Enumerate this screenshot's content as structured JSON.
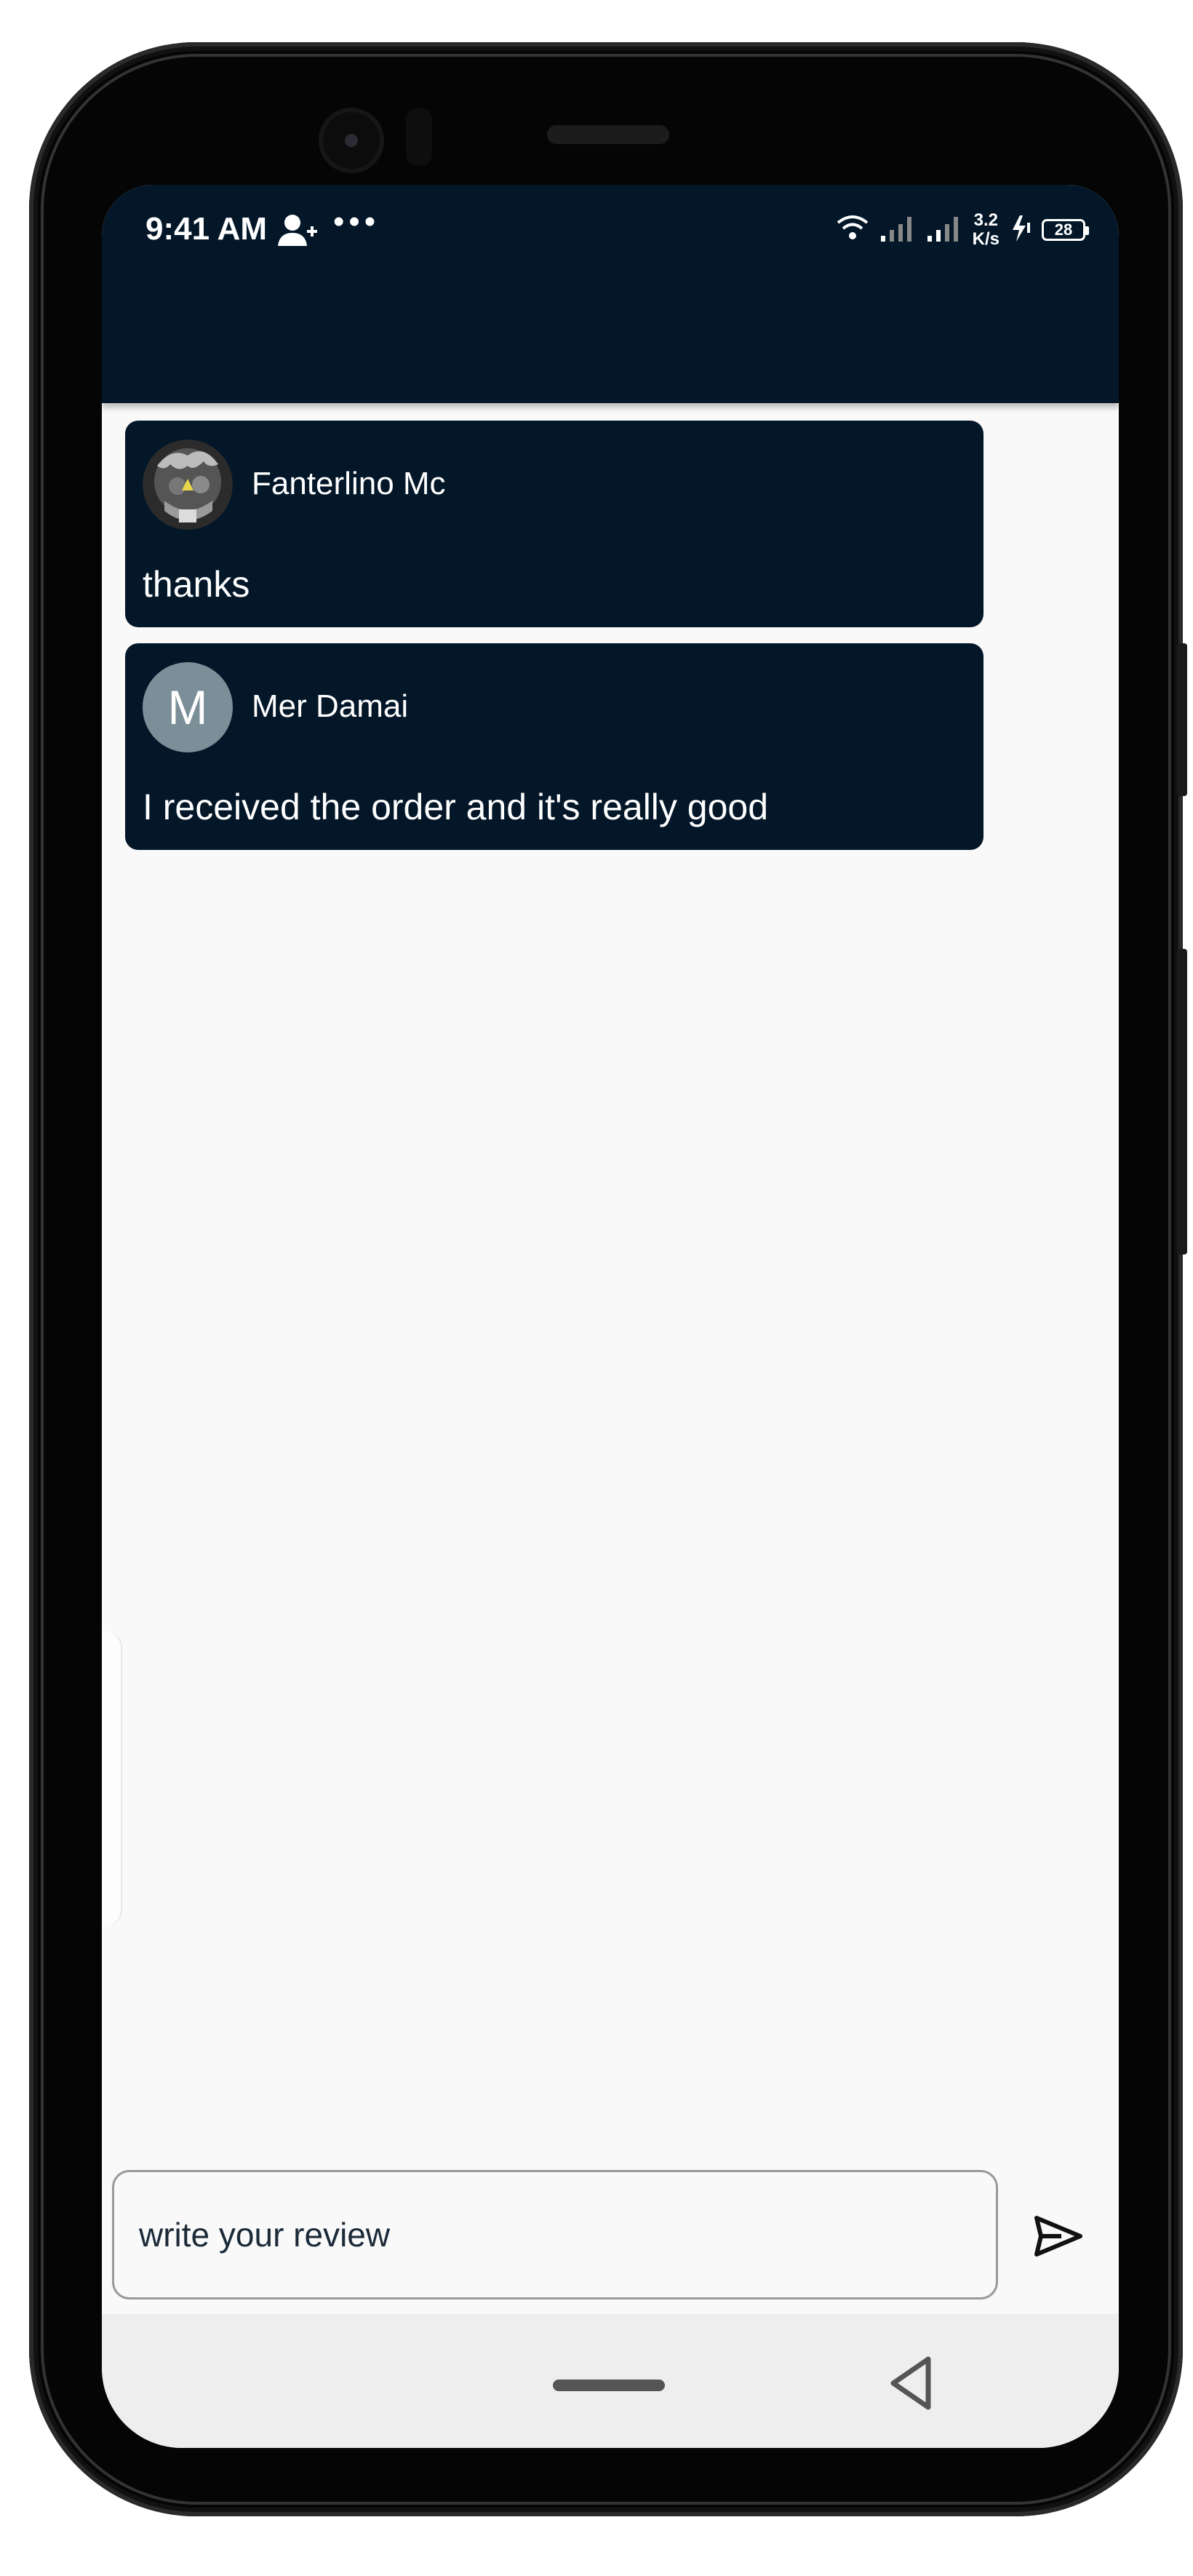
{
  "status_bar": {
    "time": "9:41 AM",
    "dots": "•••",
    "speed_value": "3.2",
    "speed_unit": "K/s",
    "battery": "28",
    "icons": [
      "person-add-icon",
      "wifi-icon",
      "signal-icon",
      "signal-icon",
      "charging-icon",
      "battery-icon"
    ]
  },
  "reviews": [
    {
      "name": "Fanterlino Mc",
      "text": "thanks",
      "avatar": "photo"
    },
    {
      "name": "Mer Damai",
      "text": "I received the order and it's really good",
      "avatar_letter": "M"
    }
  ],
  "composer": {
    "placeholder": "write your review",
    "send_icon": "send-icon"
  },
  "nav_bar": {
    "home_icon": "home-pill-icon",
    "back_icon": "back-triangle-icon"
  },
  "colors": {
    "header_bg": "#031729",
    "card_bg": "#031729",
    "screen_bg": "#f9f9f9",
    "avatar_bg": "#7b8f99"
  }
}
